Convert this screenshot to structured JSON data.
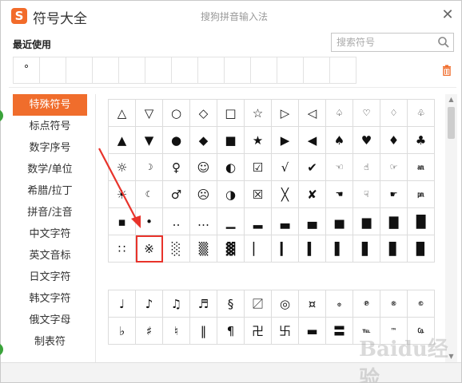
{
  "app": {
    "title": "符号大全",
    "subtitle": "搜狗拼音输入法",
    "logo": "S"
  },
  "recent": {
    "label": "最近使用",
    "items": [
      "°",
      "",
      "",
      "",
      "",
      "",
      "",
      "",
      "",
      "",
      "",
      "",
      ""
    ]
  },
  "search": {
    "placeholder": "搜索符号",
    "value": ""
  },
  "sidebar": {
    "active_index": 0,
    "items": [
      "特殊符号",
      "标点符号",
      "数字序号",
      "数学/单位",
      "希腊/拉丁",
      "拼音/注音",
      "中文字符",
      "英文音标",
      "日文字符",
      "韩文字符",
      "俄文字母",
      "制表符"
    ]
  },
  "grid1": [
    [
      "△",
      "▽",
      "○",
      "◇",
      "□",
      "☆",
      "▷",
      "◁",
      "♤",
      "♡",
      "♢",
      "♧"
    ],
    [
      "▲",
      "▼",
      "●",
      "◆",
      "■",
      "★",
      "▶",
      "◀",
      "♠",
      "♥",
      "♦",
      "♣"
    ],
    [
      "☼",
      "☽",
      "♀",
      "☺",
      "◐",
      "☑",
      "√",
      "✔",
      "☜",
      "☝",
      "☞",
      "㏂"
    ],
    [
      "☀",
      "☾",
      "♂",
      "☹",
      "◑",
      "☒",
      "╳",
      "✘",
      "☚",
      "☟",
      "☛",
      "㏘"
    ],
    [
      "▪",
      "•",
      "‥",
      "…",
      "▁",
      "▂",
      "▃",
      "▄",
      "▅",
      "▆",
      "▇",
      "█"
    ],
    [
      "∷",
      "※",
      "░",
      "▒",
      "▓",
      "▏",
      "▎",
      "▍",
      "▌",
      "▋",
      "▊",
      "▉"
    ]
  ],
  "grid2": [
    [
      "♩",
      "♪",
      "♫",
      "♬",
      "§",
      "〼",
      "◎",
      "¤",
      "۞",
      "℗",
      "®",
      "©"
    ],
    [
      "♭",
      "♯",
      "♮",
      "‖",
      "¶",
      "卍",
      "卐",
      "▬",
      "〓",
      "℡",
      "™",
      "㏇"
    ]
  ],
  "highlight": {
    "row": 5,
    "col": 1
  },
  "watermark": "Baidu经验",
  "colors": {
    "accent": "#f06d2c",
    "highlight_box": "#e8332b",
    "arrow": "#e8332b"
  },
  "icons": {
    "close": "close-icon",
    "search": "search-icon",
    "trash": "trash-icon",
    "logo": "sogou-logo-icon"
  }
}
